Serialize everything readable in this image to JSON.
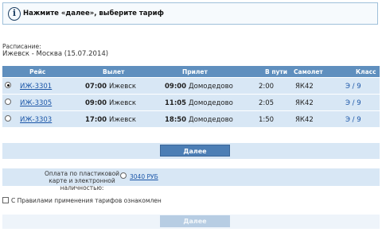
{
  "header": {
    "icon": "info-icon",
    "text": "Нажмите «далее», выберите тариф"
  },
  "route": {
    "label": "Расписание:",
    "value": "Ижевск - Москва (15.07.2014)"
  },
  "table": {
    "columns": [
      "Рейс",
      "Вылет",
      "Прилет",
      "В пути",
      "Самолет",
      "Класс"
    ],
    "rows": [
      {
        "selected": true,
        "flight": "ИЖ-3301",
        "dep_time": "07:00",
        "dep_city": "Ижевск",
        "arr_time": "09:00",
        "arr_city": "Домодедово",
        "duration": "2:00",
        "aircraft": "ЯК42",
        "class": "Э / 9"
      },
      {
        "selected": false,
        "flight": "ИЖ-3305",
        "dep_time": "09:00",
        "dep_city": "Ижевск",
        "arr_time": "11:05",
        "arr_city": "Домодедово",
        "duration": "2:05",
        "aircraft": "ЯК42",
        "class": "Э / 9"
      },
      {
        "selected": false,
        "flight": "ИЖ-3303",
        "dep_time": "17:00",
        "dep_city": "Ижевск",
        "arr_time": "18:50",
        "arr_city": "Домодедово",
        "duration": "1:50",
        "aircraft": "ЯК42",
        "class": "Э / 9"
      }
    ]
  },
  "next_button": {
    "label": "Далее"
  },
  "payment": {
    "label": "Оплата по пластиковой карте и электронной наличностью:",
    "price": "3040 РУБ"
  },
  "rules": {
    "label": "С Правилами применения тарифов ознакомлен",
    "checked": false
  },
  "next_button_disabled": {
    "label": "Далее"
  },
  "colors": {
    "header_bg": "#5f8fbe",
    "row_bg": "#d8e7f5",
    "button": "#4c7eb5",
    "link": "#1b56a8"
  }
}
